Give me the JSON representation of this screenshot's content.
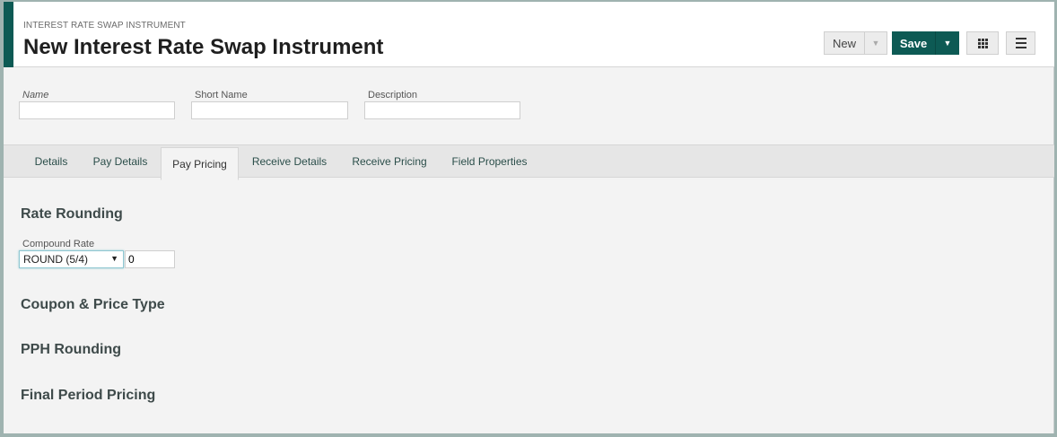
{
  "header": {
    "eyebrow": "INTEREST RATE SWAP INSTRUMENT",
    "title": "New Interest Rate Swap Instrument",
    "new_label": "New",
    "save_label": "Save",
    "accent_color": "#0d5a54"
  },
  "fields": {
    "name": {
      "label": "Name",
      "value": ""
    },
    "short_name": {
      "label": "Short Name",
      "value": ""
    },
    "description": {
      "label": "Description",
      "value": ""
    }
  },
  "tabs": [
    {
      "label": "Details"
    },
    {
      "label": "Pay Details"
    },
    {
      "label": "Pay Pricing",
      "active": true
    },
    {
      "label": "Receive Details"
    },
    {
      "label": "Receive Pricing"
    },
    {
      "label": "Field Properties"
    }
  ],
  "sections": {
    "rate_rounding": {
      "title": "Rate Rounding",
      "compound_rate_label": "Compound Rate",
      "compound_rate_method": "ROUND (5/4)",
      "compound_rate_digits": "0"
    },
    "coupon_price_type": {
      "title": "Coupon & Price Type"
    },
    "pph_rounding": {
      "title": "PPH Rounding"
    },
    "final_period_pricing": {
      "title": "Final Period Pricing"
    }
  },
  "icons": {
    "new_dropdown": "chevron-down-icon",
    "save_dropdown": "chevron-down-icon",
    "grid": "grid-icon",
    "menu": "hamburger-menu-icon"
  }
}
